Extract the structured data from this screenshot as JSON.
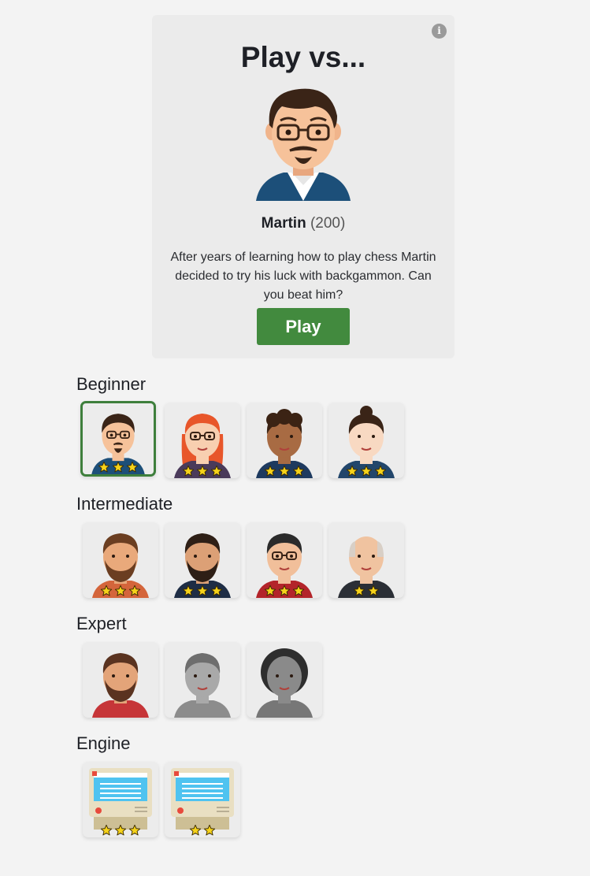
{
  "featured": {
    "title": "Play vs...",
    "name": "Martin",
    "rating": "(200)",
    "description": "After years of learning how to play chess Martin decided to try his luck with backgammon. Can you beat him?",
    "play_label": "Play",
    "info_glyph": "i"
  },
  "sections": [
    {
      "label": "Beginner",
      "opponents": [
        {
          "avatar": "martin",
          "stars": 3,
          "selected": true
        },
        {
          "avatar": "redhead-woman-glasses",
          "stars": 3
        },
        {
          "avatar": "curly-boy",
          "stars": 3
        },
        {
          "avatar": "bun-girl",
          "stars": 3
        }
      ]
    },
    {
      "label": "Intermediate",
      "opponents": [
        {
          "avatar": "bearded-man-orange",
          "stars": 3
        },
        {
          "avatar": "bearded-man-suit",
          "stars": 3
        },
        {
          "avatar": "glasses-man-red",
          "stars": 3
        },
        {
          "avatar": "old-man-suit",
          "stars": 2
        }
      ]
    },
    {
      "label": "Expert",
      "opponents": [
        {
          "avatar": "bearded-man-plaid",
          "stars": 0
        },
        {
          "avatar": "gray-man-locked",
          "stars": 0
        },
        {
          "avatar": "gray-woman-locked",
          "stars": 0
        }
      ]
    },
    {
      "label": "Engine",
      "opponents": [
        {
          "avatar": "computer",
          "stars": 3
        },
        {
          "avatar": "computer",
          "stars": 2
        }
      ]
    }
  ],
  "colors": {
    "accent": "#428a3e",
    "star": "#f5d21a",
    "background": "#f3f3f3",
    "card": "#ebebeb"
  }
}
